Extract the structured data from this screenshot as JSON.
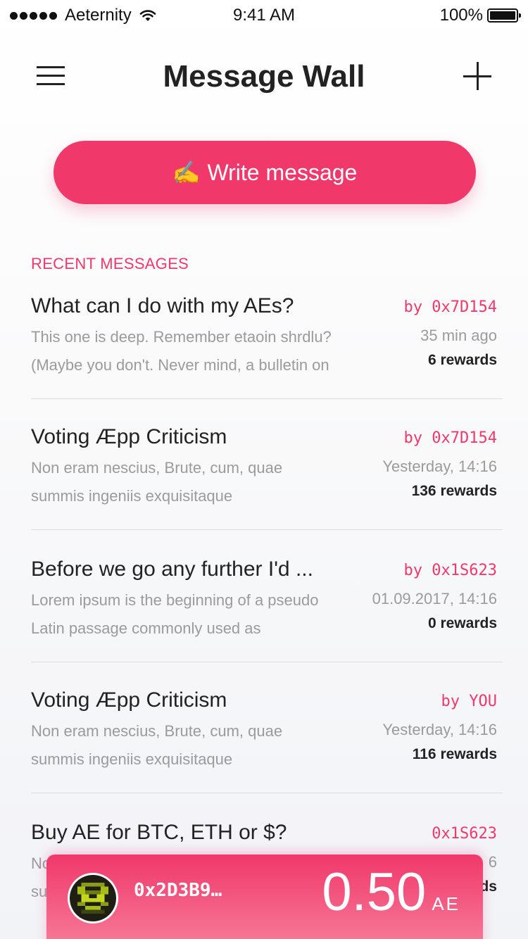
{
  "status_bar": {
    "carrier": "Aeternity",
    "time": "9:41 AM",
    "battery": "100%"
  },
  "header": {
    "title": "Message Wall",
    "menu_icon": "menu-icon",
    "add_icon": "plus-icon"
  },
  "write_button": {
    "emoji": "✍️",
    "label": "Write message"
  },
  "section_label": "RECENT MESSAGES",
  "messages": [
    {
      "title": "What can I do with my AEs?",
      "line1": "This one is deep. Remember etaoin shrdlu?",
      "line2": "(Maybe you don't. Never mind, a bulletin on",
      "author": "by 0x7D154",
      "time": "35 min ago",
      "rewards": "6 rewards"
    },
    {
      "title": "Voting Æpp Criticism",
      "line1": "Non eram nescius, Brute, cum, quae",
      "line2": "summis ingeniis exquisitaque",
      "author": "by 0x7D154",
      "time": "Yesterday, 14:16",
      "rewards": "136 rewards"
    },
    {
      "title": "Before we go any further I'd ...",
      "line1": "Lorem ipsum is the beginning of a pseudo",
      "line2": "Latin passage commonly used as",
      "author": "by 0x1S623",
      "time": "01.09.2017, 14:16",
      "rewards": "0 rewards"
    },
    {
      "title": "Voting Æpp Criticism",
      "line1": "Non eram nescius, Brute, cum, quae",
      "line2": "summis ingeniis exquisitaque",
      "author": "by YOU",
      "time": "Yesterday, 14:16",
      "rewards": "116 rewards"
    },
    {
      "title": "Buy AE for BTC, ETH or $?",
      "line1": "No",
      "line2": "su",
      "author": "0x1S623",
      "time": "6",
      "rewards": "ds"
    }
  ],
  "account": {
    "address": "0x2D3B9…",
    "balance": "0.50",
    "unit": "AE"
  },
  "colors": {
    "accent": "#f0386b",
    "text": "#222222",
    "muted": "#9b9b9b"
  }
}
